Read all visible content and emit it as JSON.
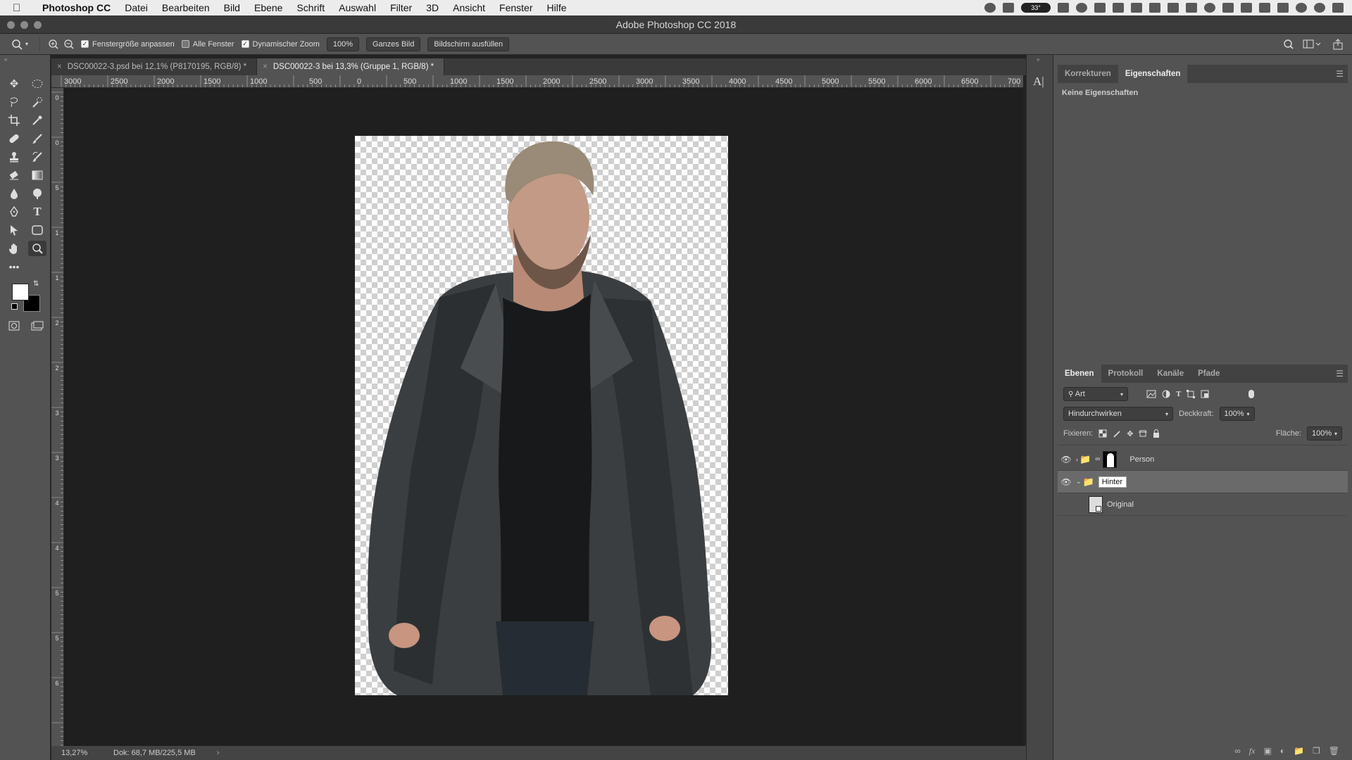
{
  "menubar": {
    "app_name": "Photoshop CC",
    "items": [
      "Datei",
      "Bearbeiten",
      "Bild",
      "Ebene",
      "Schrift",
      "Auswahl",
      "Filter",
      "3D",
      "Ansicht",
      "Fenster",
      "Hilfe"
    ],
    "tray_badge": "33°"
  },
  "window": {
    "title": "Adobe Photoshop CC 2018"
  },
  "options": {
    "fit_window_label": "Fenstergröße anpassen",
    "fit_window_checked": true,
    "all_windows_label": "Alle Fenster",
    "all_windows_checked": false,
    "scrubby_zoom_label": "Dynamischer Zoom",
    "scrubby_zoom_checked": true,
    "btn_100": "100%",
    "btn_fit": "Ganzes Bild",
    "btn_fill": "Bildschirm ausfüllen"
  },
  "tabs": [
    {
      "label": "DSC00022-3.psd bei 12,1% (P8170195, RGB/8) *",
      "active": false
    },
    {
      "label": "DSC00022-3 bei 13,3% (Gruppe 1, RGB/8) *",
      "active": true
    }
  ],
  "ruler_top": [
    "3000",
    "2500",
    "2000",
    "1500",
    "1000",
    "500",
    "0",
    "500",
    "1000",
    "1500",
    "2000",
    "2500",
    "3000",
    "3500",
    "4000",
    "4500",
    "5000",
    "5500",
    "6000",
    "6500",
    "700"
  ],
  "ruler_left": [
    "0",
    "0",
    "5",
    "1",
    "1",
    "2",
    "2",
    "3",
    "3",
    "4",
    "4",
    "5",
    "5",
    "6"
  ],
  "status": {
    "zoom": "13,27%",
    "doc": "Dok: 68,7 MB/225,5 MB"
  },
  "properties_panel": {
    "tabs": [
      "Korrekturen",
      "Eigenschaften"
    ],
    "active_tab": "Eigenschaften",
    "empty_text": "Keine Eigenschaften"
  },
  "layers_panel": {
    "tabs": [
      "Ebenen",
      "Protokoll",
      "Kanäle",
      "Pfade"
    ],
    "active_tab": "Ebenen",
    "filter_label": "Art",
    "blend_mode": "Hindurchwirken",
    "opacity_label": "Deckkraft:",
    "opacity_value": "100%",
    "lock_label": "Fixieren:",
    "fill_label": "Fläche:",
    "fill_value": "100%",
    "layers": [
      {
        "name": "Person",
        "type": "group",
        "visible": true,
        "selected": false
      },
      {
        "name": "Hinter",
        "type": "group",
        "visible": true,
        "selected": true,
        "editing": true
      },
      {
        "name": "Original",
        "type": "smart",
        "visible": false,
        "selected": false
      }
    ]
  }
}
